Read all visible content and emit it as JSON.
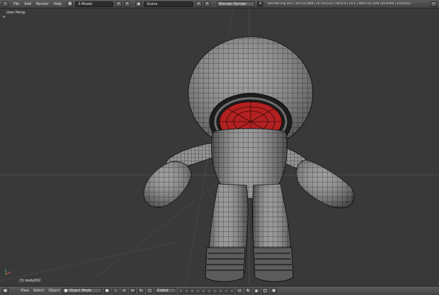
{
  "topbar": {
    "menu": [
      "File",
      "Add",
      "Render",
      "Help"
    ],
    "layout_name": "3-Model",
    "scene_name": "Scene",
    "render_engine": "Blender Render",
    "stats": "blender.org 262 | Ve:102,868 | Fa:101532 | Ob:0-4 | La:1 | Mem:50.12M (44.85M) | body002"
  },
  "viewport": {
    "view_label": "User Persp",
    "object_label": "(3) body002"
  },
  "bottombar": {
    "menu": [
      "View",
      "Select",
      "Object"
    ],
    "mode": "Object Mode",
    "orientation": "Global"
  }
}
